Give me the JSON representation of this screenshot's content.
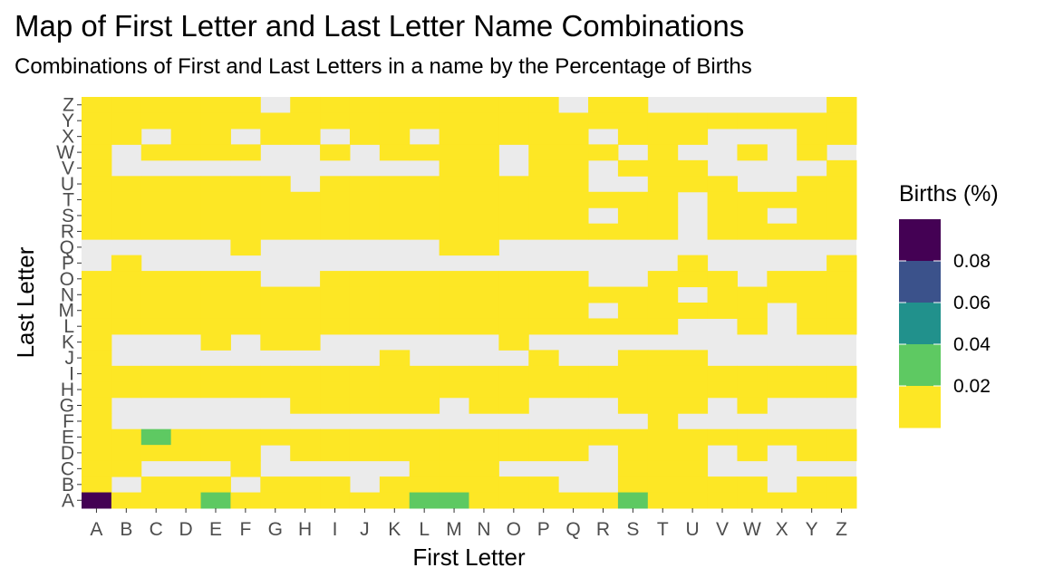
{
  "title": "Map of First Letter and Last Letter Name Combinations",
  "subtitle": "Combinations of First and Last Letters in a name by the Percentage of Births",
  "chart_data": {
    "type": "heatmap",
    "xlabel": "First Letter",
    "ylabel": "Last Letter",
    "x_categories": [
      "A",
      "B",
      "C",
      "D",
      "E",
      "F",
      "G",
      "H",
      "I",
      "J",
      "K",
      "L",
      "M",
      "N",
      "O",
      "P",
      "Q",
      "R",
      "S",
      "T",
      "U",
      "V",
      "W",
      "X",
      "Y",
      "Z"
    ],
    "y_categories": [
      "A",
      "B",
      "C",
      "D",
      "E",
      "F",
      "G",
      "H",
      "I",
      "J",
      "K",
      "L",
      "M",
      "N",
      "O",
      "P",
      "Q",
      "R",
      "S",
      "T",
      "U",
      "V",
      "W",
      "X",
      "Y",
      "Z"
    ],
    "missing_color": "#ebebeb",
    "colorscale": [
      "#fde725",
      "#5ec962",
      "#21918c",
      "#3b528b",
      "#440154"
    ],
    "legend": {
      "title": "Births (%)",
      "ticks": [
        {
          "value": 0.02,
          "label": "0.02"
        },
        {
          "value": 0.04,
          "label": "0.04"
        },
        {
          "value": 0.06,
          "label": "0.06"
        },
        {
          "value": 0.08,
          "label": "0.08"
        }
      ]
    },
    "presence_rows_top_to_bottom": {
      "Z": "11111111111111111111111111",
      "Y": "11111111111111111111111111",
      "X": "11111111111111111111111111",
      "W": "11111111111111111111111111",
      "V": "11111111111111111111111111",
      "U": "11111111111111111111111111",
      "T": "11111111111111111111111111",
      "S": "11111111111111111111111111",
      "R": "11111111111111111111111111",
      "Q": "00000100000011000000000000",
      "P": "11111111111111111111111111",
      "O": "11111111111111111111111111",
      "N": "11111111111111111111111111",
      "M": "11111111111111111111111111",
      "L": "11111111111111111111111111",
      "K": "11111111111111111111111111",
      "J": "11111111111111111111111111",
      "I": "11111111111111111111111111",
      "H": "11111111111111111111111111",
      "G": "11111111111111111111111111",
      "F": "11111111111111111111111111",
      "E": "11111111111111111111111111",
      "D": "11111111111111111111111111",
      "C": "11111111111111111111111111",
      "B": "11111111111111111111111111",
      "A": "11111111111111111111111111"
    },
    "presence_detail_top_to_bottom": [
      "11111101111111110110000001",
      "11111111111111111111111111",
      "11011011011011111011100011",
      "10111100101111011101001010",
      "10000000000011011011100001",
      "11111110111111111001110011",
      "11111111111111111111011111",
      "11111111111111111011011011",
      "11111111111111111111011111",
      "00000100000011000000000000",
      "01000000000000000000100001",
      "11111100111111111001110111",
      "11111111111111111111011111",
      "11111111111111111011111011",
      "11111111111111111111001011",
      "10001011000000100000000000",
      "10000000001000010011100000",
      "11111111111111111111111111",
      "11111111111111111111111111",
      "10000001111101100011101000",
      "10000000000000000001000000",
      "11111111111111111111111111",
      "11111101111111111011101011",
      "11000100000111000011100000",
      "10111011101111110011111011",
      "11111111111111111111111111"
    ],
    "nonzero_cells": [
      {
        "first": "A",
        "last": "A",
        "value": 0.09
      },
      {
        "first": "E",
        "last": "A",
        "value": 0.03
      },
      {
        "first": "L",
        "last": "A",
        "value": 0.03
      },
      {
        "first": "M",
        "last": "A",
        "value": 0.03
      },
      {
        "first": "S",
        "last": "A",
        "value": 0.03
      },
      {
        "first": "C",
        "last": "E",
        "value": 0.03
      }
    ],
    "default_present_value": 0.005
  }
}
